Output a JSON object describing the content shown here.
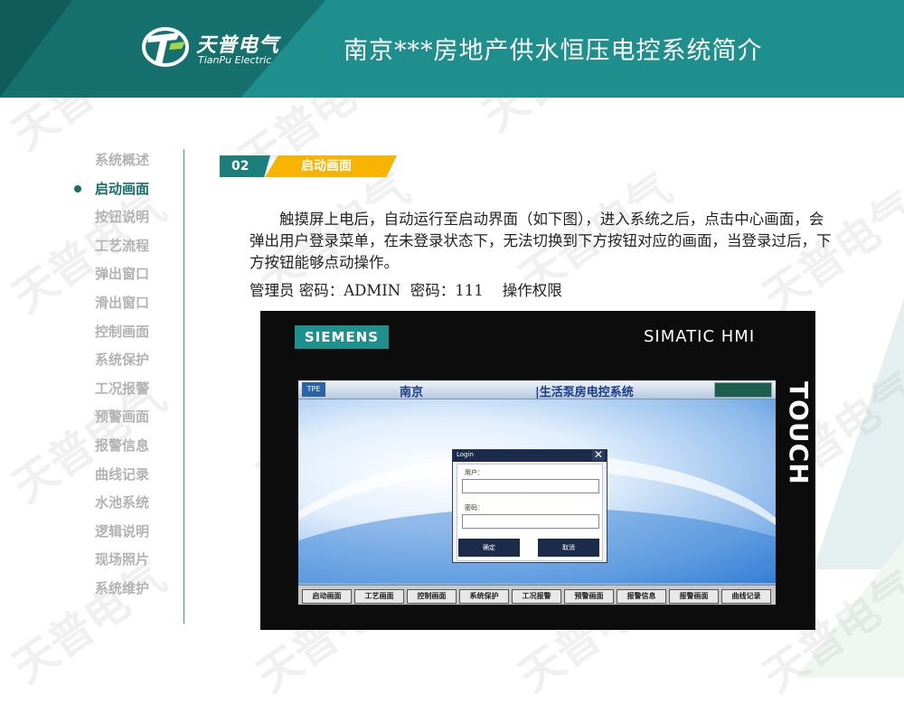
{
  "header": {
    "logo_name": "天普电气",
    "logo_sub": "TianPu Electric",
    "title": "南京***房地产供水恒压电控系统简介"
  },
  "nav": {
    "items": [
      {
        "label": "系统概述"
      },
      {
        "label": "启动画面",
        "active": true
      },
      {
        "label": "按钮说明"
      },
      {
        "label": "工艺流程"
      },
      {
        "label": "弹出窗口"
      },
      {
        "label": "滑出窗口"
      },
      {
        "label": "控制画面"
      },
      {
        "label": "系统保护"
      },
      {
        "label": "工况报警"
      },
      {
        "label": "预警画面"
      },
      {
        "label": "报警信息"
      },
      {
        "label": "曲线记录"
      },
      {
        "label": "水池系统"
      },
      {
        "label": "逻辑说明"
      },
      {
        "label": "现场照片"
      },
      {
        "label": "系统维护"
      }
    ]
  },
  "section": {
    "number": "02",
    "name": "启动画面"
  },
  "content": {
    "description": "触摸屏上电后，自动运行至启动界面（如下图），进入系统之后，点击中心画面，会弹出用户登录菜单，在未登录状态下，无法切换到下方按钮对应的画面，当登录过后，下方按钮能够点动操作。",
    "credentials": "管理员 密码：ADMIN  密码：111    操作权限"
  },
  "hmi": {
    "brand": "SIEMENS",
    "model": "SIMATIC HMI",
    "touch_label": "TOUCH",
    "screen": {
      "logo": "TPE",
      "city": "南京",
      "system_title": "|生活泵房电控系统",
      "login": {
        "title": "Login",
        "close": "✕",
        "user_label": "用户：",
        "password_label": "密码：",
        "ok": "确定",
        "cancel": "取消"
      },
      "footer_buttons": [
        "启动画面",
        "工艺画面",
        "控制画面",
        "系统保护",
        "工况报警",
        "预警画面",
        "报警信息",
        "报警画面",
        "曲线记录"
      ]
    }
  },
  "watermark": "天普电气",
  "colors": {
    "header_teal": "#1e8f8c",
    "accent_teal": "#1b6d6a",
    "accent_orange": "#f6b400"
  }
}
